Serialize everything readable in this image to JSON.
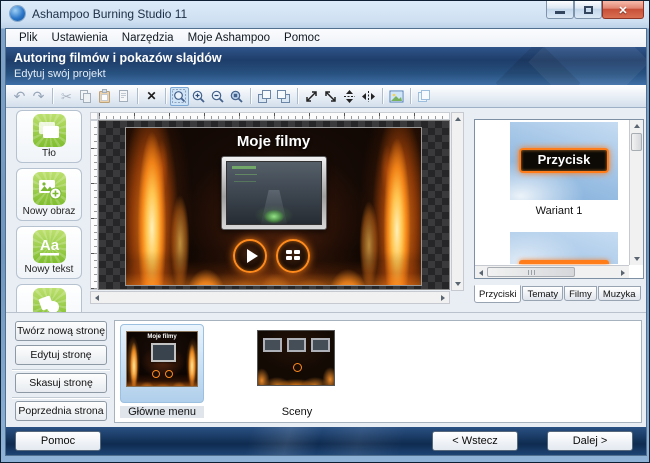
{
  "window": {
    "title": "Ashampoo Burning Studio 11"
  },
  "menu": {
    "items": [
      "Plik",
      "Ustawienia",
      "Narzędzia",
      "Moje Ashampoo",
      "Pomoc"
    ]
  },
  "header": {
    "title": "Autoring filmów i pokazów slajdów",
    "subtitle": "Edytuj swój projekt"
  },
  "toolbar": {
    "icons": [
      "undo",
      "redo",
      "sep",
      "cut",
      "copy",
      "paste",
      "paste-page",
      "sep",
      "delete",
      "sep",
      "zoom-region",
      "zoom-in",
      "zoom-out",
      "zoom-fit",
      "sep",
      "bring-forward",
      "send-backward",
      "sep",
      "resize-diagonal",
      "resize-diagonal-2",
      "center-vertical",
      "center-horizontal",
      "sep",
      "image-properties",
      "sep",
      "duplicate"
    ]
  },
  "sidebar": {
    "buttons": [
      {
        "label": "Tło",
        "icon": "background"
      },
      {
        "label": "Nowy obraz",
        "icon": "new-image"
      },
      {
        "label": "Nowy tekst",
        "icon": "new-text"
      },
      {
        "label": "",
        "icon": "new-shape"
      }
    ]
  },
  "canvas": {
    "menu_title": "Moje filmy"
  },
  "right_panel": {
    "items": [
      {
        "preview": "Przycisk",
        "label": "Wariant 1"
      }
    ],
    "tabs": [
      {
        "label": "Przyciski",
        "active": true
      },
      {
        "label": "Tematy",
        "active": false
      },
      {
        "label": "Filmy",
        "active": false
      },
      {
        "label": "Muzyka",
        "active": false
      }
    ]
  },
  "page_actions": {
    "buttons": [
      "Twórz nową stronę",
      "Edytuj stronę",
      "Skasuj stronę",
      "Poprzednia strona"
    ]
  },
  "pages": [
    {
      "label": "Główne menu",
      "selected": true
    },
    {
      "label": "Sceny",
      "selected": false
    }
  ],
  "footer": {
    "help": "Pomoc",
    "back": "< Wstecz",
    "next": "Dalej >"
  },
  "colors": {
    "accent_green": "#8dc63f",
    "fire_orange": "#ff8a1e",
    "header_blue": "#24497e"
  }
}
